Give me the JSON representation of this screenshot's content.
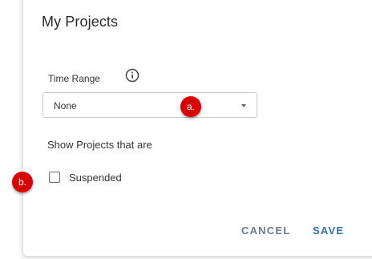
{
  "dialog": {
    "title": "My Projects",
    "time_range": {
      "label": "Time Range",
      "info_icon": "info-circle-icon",
      "selected_value": "None"
    },
    "show_section": {
      "label": "Show Projects that are",
      "checkbox_label": "Suspended",
      "checked": false
    },
    "buttons": {
      "cancel": "CANCEL",
      "save": "SAVE"
    }
  },
  "annotations": {
    "a": "a.",
    "b": "b."
  },
  "colors": {
    "save": "#2f6fae",
    "cancel": "#707a86",
    "badge": "#d80000"
  }
}
